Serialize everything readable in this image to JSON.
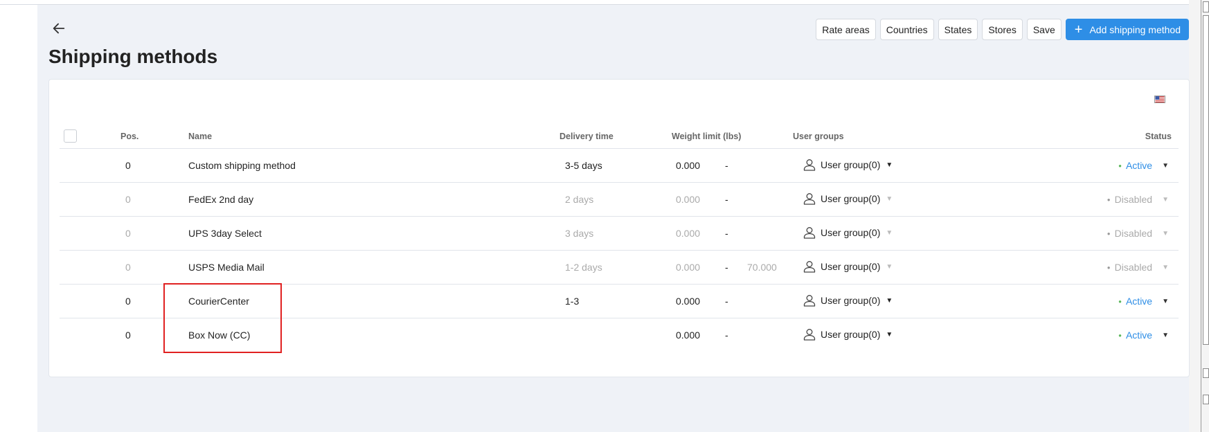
{
  "page": {
    "title": "Shipping methods"
  },
  "toolbar": {
    "rate_areas": "Rate areas",
    "countries": "Countries",
    "states": "States",
    "stores": "Stores",
    "save": "Save",
    "add": "Add shipping method",
    "add_icon": "+"
  },
  "table": {
    "headers": {
      "pos": "Pos.",
      "name": "Name",
      "delivery": "Delivery time",
      "weight": "Weight limit (lbs)",
      "groups": "User groups",
      "status": "Status"
    },
    "rows": [
      {
        "pos": "0",
        "name": "Custom shipping method",
        "delivery": "3-5 days",
        "wmin": "0.000",
        "dash": "-",
        "wmax": "",
        "group": "User group(0)",
        "status": "Active"
      },
      {
        "pos": "0",
        "name": "FedEx 2nd day",
        "delivery": "2 days",
        "wmin": "0.000",
        "dash": "-",
        "wmax": "",
        "group": "User group(0)",
        "status": "Disabled"
      },
      {
        "pos": "0",
        "name": "UPS 3day Select",
        "delivery": "3 days",
        "wmin": "0.000",
        "dash": "-",
        "wmax": "",
        "group": "User group(0)",
        "status": "Disabled"
      },
      {
        "pos": "0",
        "name": "USPS Media Mail",
        "delivery": "1-2 days",
        "wmin": "0.000",
        "dash": "-",
        "wmax": "70.000",
        "group": "User group(0)",
        "status": "Disabled"
      },
      {
        "pos": "0",
        "name": "CourierCenter",
        "delivery": "1-3",
        "wmin": "0.000",
        "dash": "-",
        "wmax": "",
        "group": "User group(0)",
        "status": "Active"
      },
      {
        "pos": "0",
        "name": "Box Now (CC)",
        "delivery": "",
        "wmin": "0.000",
        "dash": "-",
        "wmax": "",
        "group": "User group(0)",
        "status": "Active"
      }
    ]
  },
  "colors": {
    "primary": "#2e8ee6",
    "active_dot": "#5cb85c",
    "highlight": "#e02020",
    "background": "#eff2f7"
  },
  "icons": {
    "back": "arrow-left-icon",
    "user": "user-icon",
    "caret": "caret-down-icon",
    "flag": "us-flag-icon"
  }
}
